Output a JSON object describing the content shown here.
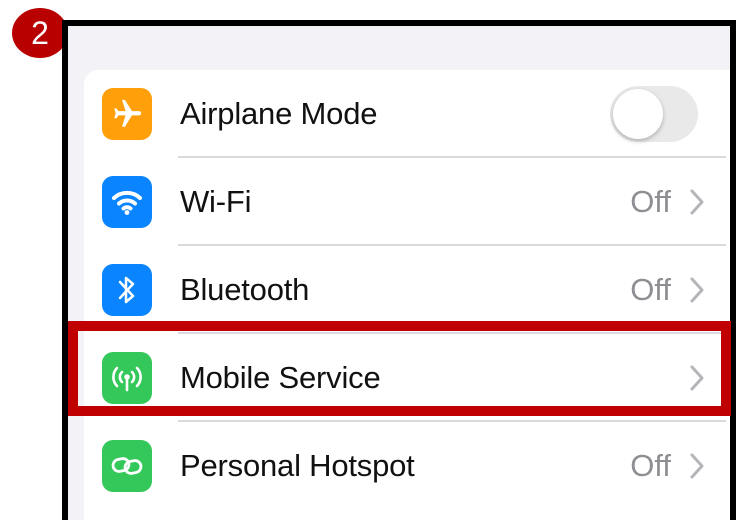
{
  "step_badge": "2",
  "colors": {
    "highlight": "#c00000",
    "badge": "#b80000",
    "airplane_icon_bg": "#ff9f0a",
    "wifi_icon_bg": "#0a84ff",
    "bluetooth_icon_bg": "#0a84ff",
    "mobile_icon_bg": "#34c759",
    "hotspot_icon_bg": "#34c759"
  },
  "settings": {
    "rows": [
      {
        "label": "Airplane Mode",
        "icon": "airplane-icon",
        "control": "toggle",
        "toggle_state": "off"
      },
      {
        "label": "Wi-Fi",
        "icon": "wifi-icon",
        "value": "Off"
      },
      {
        "label": "Bluetooth",
        "icon": "bluetooth-icon",
        "value": "Off"
      },
      {
        "label": "Mobile Service",
        "icon": "antenna-icon",
        "value": "",
        "highlighted": true
      },
      {
        "label": "Personal Hotspot",
        "icon": "hotspot-link-icon",
        "value": "Off"
      }
    ]
  }
}
